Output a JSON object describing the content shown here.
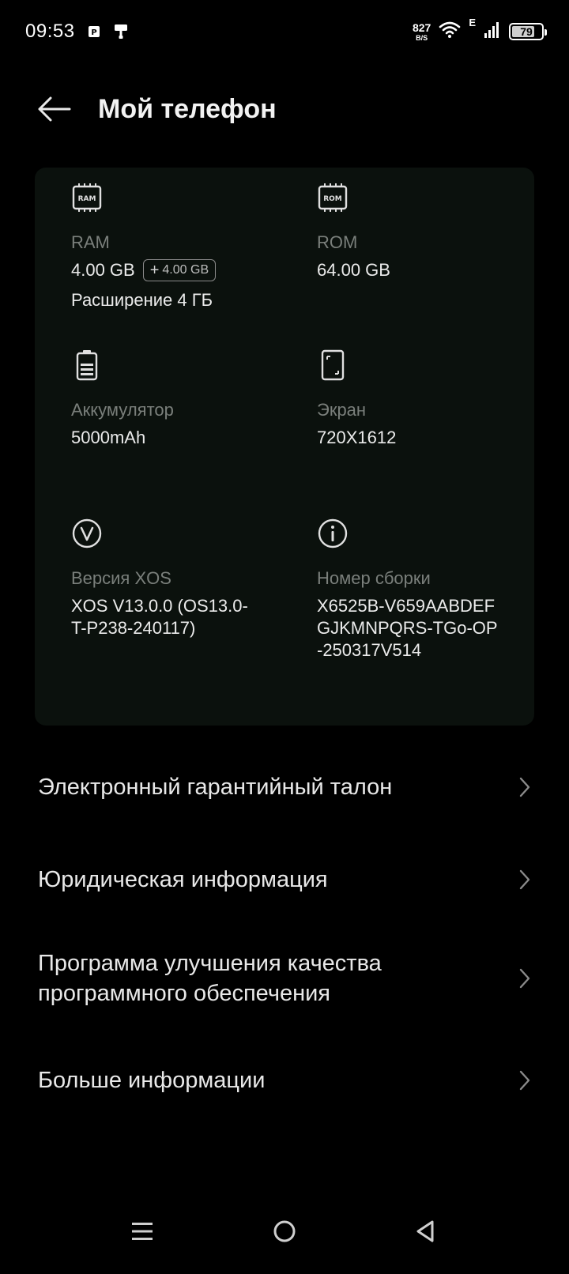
{
  "status_bar": {
    "time": "09:53",
    "net_speed_value": "827",
    "net_speed_unit": "B/S",
    "network_type": "E",
    "battery_level": "79",
    "battery_fraction": 0.79,
    "icons": [
      "notification-p-icon",
      "notification-brush-icon",
      "wifi-icon",
      "signal-icon",
      "battery-icon"
    ]
  },
  "header": {
    "title": "Мой телефон",
    "back_icon": "arrow-left-icon"
  },
  "specs": {
    "ram": {
      "icon": "ram-chip-icon",
      "icon_text": "RAM",
      "label": "RAM",
      "value": "4.00 GB",
      "extension_badge": "4.00 GB",
      "extension_badge_prefix": "+",
      "sub": "Расширение 4 ГБ"
    },
    "rom": {
      "icon": "rom-chip-icon",
      "icon_text": "ROM",
      "label": "ROM",
      "value": "64.00 GB"
    },
    "battery": {
      "icon": "battery-icon",
      "label": "Аккумулятор",
      "value": "5000mAh"
    },
    "screen": {
      "icon": "screen-icon",
      "label": "Экран",
      "value": "720X1612"
    },
    "xos": {
      "icon": "xos-version-icon",
      "label": "Версия XOS",
      "value_line1": "XOS V13.0.0 (OS13.0-",
      "value_line2": "T-P238-240117)"
    },
    "build": {
      "icon": "info-icon",
      "label": "Номер сборки",
      "value_line1": "X6525B-V659AABDEF",
      "value_line2": "GJKMNPQRS-TGo-OP",
      "value_line3": "-250317V514"
    }
  },
  "menu": {
    "items": [
      {
        "line1": "Электронный гарантийный талон",
        "line2": ""
      },
      {
        "line1": "Юридическая информация",
        "line2": ""
      },
      {
        "line1": "Программа улучшения качества",
        "line2": "программного обеспечения"
      },
      {
        "line1": "Больше информации",
        "line2": ""
      }
    ],
    "chevron_icon": "chevron-right-icon"
  },
  "nav_bar": {
    "icons": [
      "menu-icon",
      "home-icon",
      "back-triangle-icon"
    ]
  },
  "colors": {
    "background": "#000000",
    "card": "#0b110d",
    "label_gray": "#7a7f7b",
    "text": "#ebebeb"
  }
}
